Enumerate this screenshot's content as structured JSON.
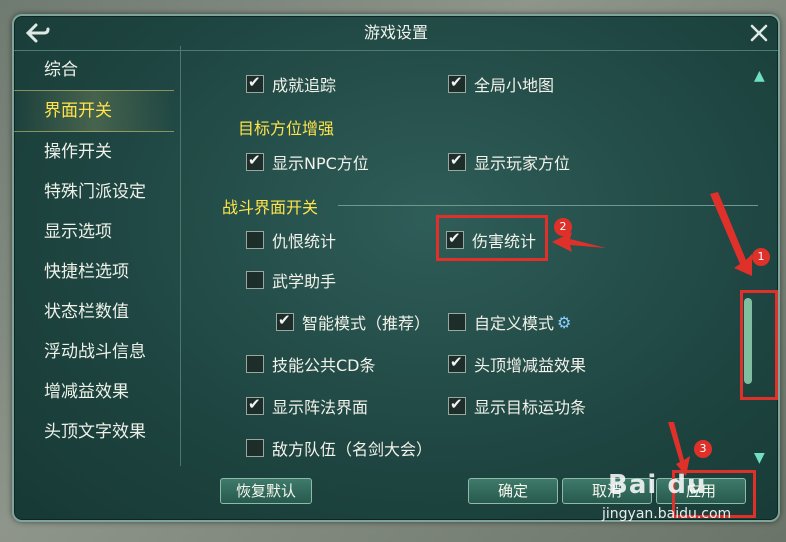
{
  "window": {
    "title": "游戏设置"
  },
  "sidebar": {
    "items": [
      {
        "label": "综合"
      },
      {
        "label": "界面开关"
      },
      {
        "label": "操作开关"
      },
      {
        "label": "特殊门派设定"
      },
      {
        "label": "显示选项"
      },
      {
        "label": "快捷栏选项"
      },
      {
        "label": "状态栏数值"
      },
      {
        "label": "浮动战斗信息"
      },
      {
        "label": "增减益效果"
      },
      {
        "label": "头顶文字效果"
      }
    ],
    "active_index": 1
  },
  "options": {
    "achievement_tracking": {
      "label": "成就追踪",
      "checked": true
    },
    "global_minimap": {
      "label": "全局小地图",
      "checked": true
    },
    "target_section": "目标方位增强",
    "show_npc_direction": {
      "label": "显示NPC方位",
      "checked": true
    },
    "show_player_direction": {
      "label": "显示玩家方位",
      "checked": true
    },
    "combat_section": "战斗界面开关",
    "hatred_stats": {
      "label": "仇恨统计",
      "checked": false
    },
    "damage_stats": {
      "label": "伤害统计",
      "checked": true
    },
    "martial_assistant": {
      "label": "武学助手",
      "checked": false
    },
    "smart_mode": {
      "label": "智能模式（推荐）",
      "checked": true
    },
    "custom_mode": {
      "label": "自定义模式",
      "checked": false
    },
    "skill_cd_bar": {
      "label": "技能公共CD条",
      "checked": false
    },
    "head_buff_effects": {
      "label": "头顶增减益效果",
      "checked": true
    },
    "show_formation_ui": {
      "label": "显示阵法界面",
      "checked": true
    },
    "show_target_cast_bar": {
      "label": "显示目标运功条",
      "checked": true
    },
    "enemy_team": {
      "label": "敌方队伍（名剑大会）",
      "checked": false
    }
  },
  "buttons": {
    "restore_default": "恢复默认",
    "confirm": "确定",
    "cancel": "取消",
    "apply": "应用"
  },
  "annotations": {
    "marker_1": "1",
    "marker_2": "2",
    "marker_3": "3",
    "color": "#e0302a"
  },
  "watermark": {
    "brand": "Bai du",
    "url": "jingyan.baidu.com"
  }
}
